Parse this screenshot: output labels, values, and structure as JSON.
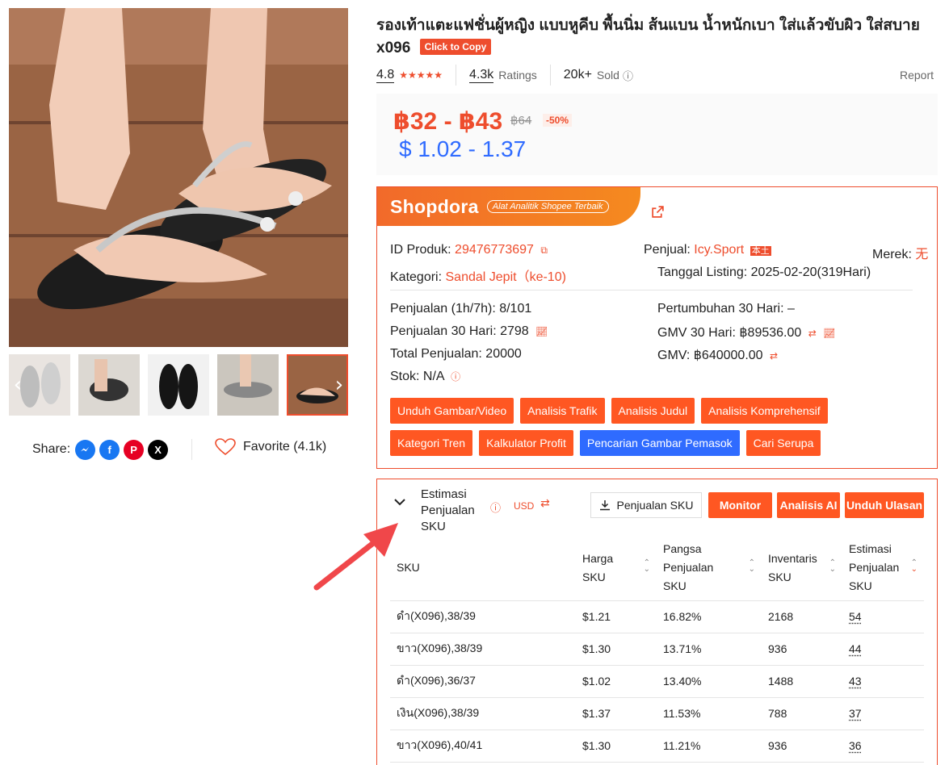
{
  "product": {
    "title": "รองเท้าแตะแฟชั่นผู้หญิง แบบหูคีบ พื้นนิ่ม ส้นแบน น้ำหนักเบา ใส่แล้วขับผิว ใส่สบาย x096",
    "copy_label": "Click to Copy",
    "rating": "4.8",
    "ratings_count": "4.3k",
    "ratings_label": "Ratings",
    "sold_count": "20k+",
    "sold_label": "Sold",
    "report_label": "Report"
  },
  "price": {
    "range": "฿32 - ฿43",
    "original": "฿64",
    "discount": "-50%",
    "usd_range": "$ 1.02 - 1.37"
  },
  "share": {
    "label": "Share:",
    "favorite_label": "Favorite (4.1k)"
  },
  "shopdora": {
    "logo": "Shopdora",
    "tagline": "Alat Analitik Shopee Terbaik",
    "product_id_label": "ID Produk:",
    "product_id": "29476773697",
    "seller_label": "Penjual:",
    "seller": "Icy.Sport",
    "seller_badge": "本土",
    "brand_label": "Merek:",
    "brand": "无",
    "category_label": "Kategori:",
    "category": "Sandal Jepit（ke-10)",
    "listing_label": "Tanggal Listing:",
    "listing_date": "2025-02-20(319Hari)",
    "sales_1h7h": "Penjualan (1h/7h): 8/101",
    "growth_30": "Pertumbuhan 30 Hari: –",
    "sales_30": "Penjualan 30 Hari: 2798",
    "gmv_30": "GMV 30 Hari: ฿89536.00",
    "total_sales": "Total Penjualan: 20000",
    "gmv": "GMV: ฿640000.00",
    "stock": "Stok: N/A",
    "buttons_row1": [
      "Unduh Gambar/Video",
      "Analisis Trafik",
      "Analisis Judul",
      "Analisis Komprehensif"
    ],
    "buttons_row2": [
      "Kategori Tren",
      "Kalkulator Profit",
      "Pencarian Gambar Pemasok",
      "Cari Serupa"
    ]
  },
  "sku": {
    "title": "Estimasi Penjualan SKU",
    "currency": "USD",
    "download_label": "Penjualan SKU",
    "monitor_label": "Monitor",
    "ai_label": "Analisis AI",
    "reviews_label": "Unduh Ulasan",
    "columns": [
      "SKU",
      "Harga SKU",
      "Pangsa Penjualan SKU",
      "Inventaris SKU",
      "Estimasi Penjualan SKU"
    ],
    "rows": [
      [
        "ดำ(X096),38/39",
        "$1.21",
        "16.82%",
        "2168",
        "54"
      ],
      [
        "ขาว(X096),38/39",
        "$1.30",
        "13.71%",
        "936",
        "44"
      ],
      [
        "ดำ(X096),36/37",
        "$1.02",
        "13.40%",
        "1488",
        "43"
      ],
      [
        "เงิน(X096),38/39",
        "$1.37",
        "11.53%",
        "788",
        "37"
      ],
      [
        "ขาว(X096),40/41",
        "$1.30",
        "11.21%",
        "936",
        "36"
      ]
    ]
  },
  "colors": {
    "accent": "#ee4d2d",
    "usd_blue": "#2f6bff"
  }
}
